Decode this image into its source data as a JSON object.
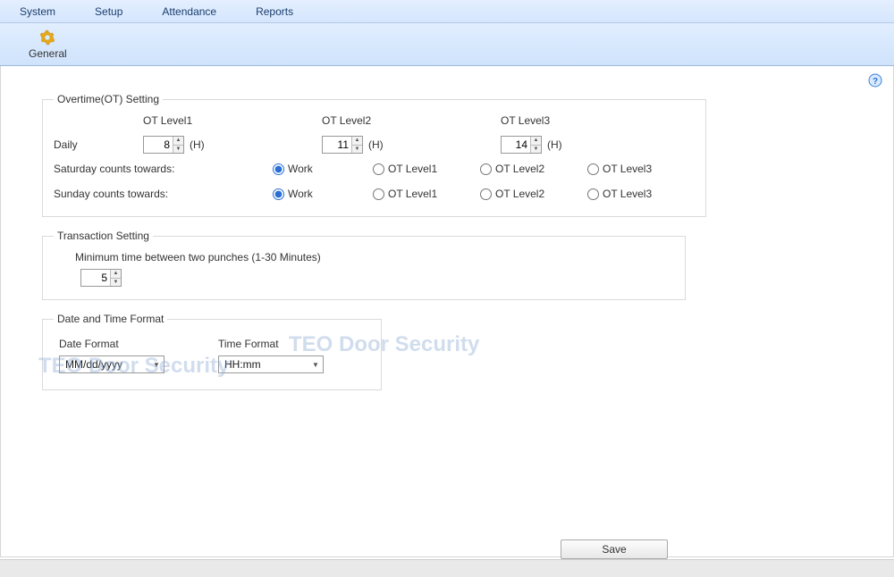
{
  "menubar": {
    "items": [
      "System",
      "Setup",
      "Attendance",
      "Reports"
    ]
  },
  "toolbar": {
    "general_label": "General"
  },
  "overtime": {
    "legend": "Overtime(OT) Setting",
    "headers": [
      "OT Level1",
      "OT Level2",
      "OT Level3"
    ],
    "daily_label": "Daily",
    "daily_values": [
      "8",
      "11",
      "14"
    ],
    "unit": "(H)",
    "saturday_label": "Saturday counts towards:",
    "sunday_label": "Sunday counts towards:",
    "radio_options": [
      "Work",
      "OT Level1",
      "OT Level2",
      "OT Level3"
    ],
    "saturday_selected": "Work",
    "sunday_selected": "Work"
  },
  "transaction": {
    "legend": "Transaction Setting",
    "label": "Minimum time between two punches (1-30 Minutes)",
    "value": "5"
  },
  "datetime": {
    "legend": "Date and Time Format",
    "date_label": "Date Format",
    "date_value": "MM/dd/yyyy",
    "time_label": "Time Format",
    "time_value": "HH:mm"
  },
  "save_label": "Save",
  "watermark": "TEO Door Security"
}
